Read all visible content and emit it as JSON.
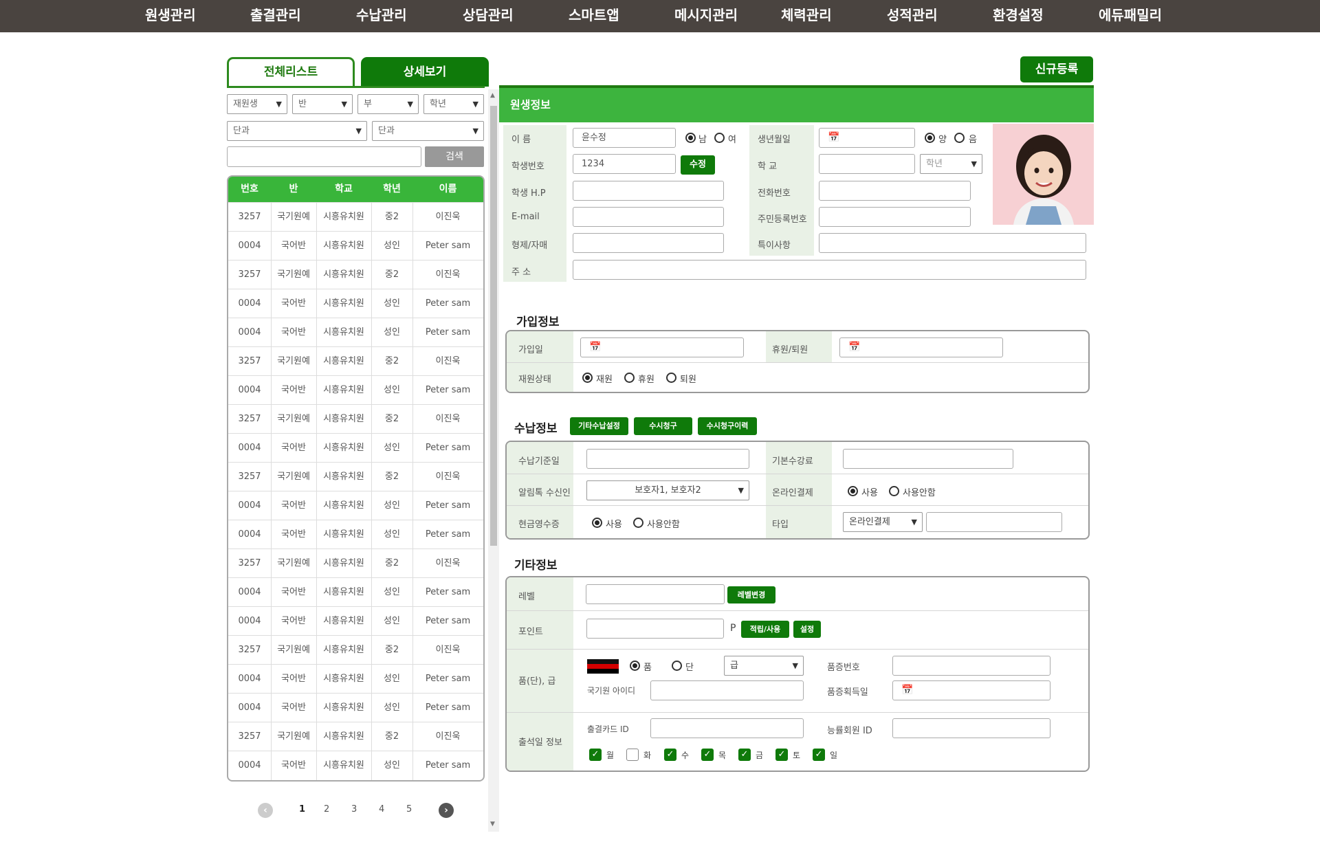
{
  "topnav": [
    "원생관리",
    "출결관리",
    "수납관리",
    "상담관리",
    "스마트앱",
    "메시지관리",
    "체력관리",
    "성적관리",
    "환경설정",
    "에듀패밀리"
  ],
  "tabs": {
    "list": "전체리스트",
    "detail": "상세보기"
  },
  "new_button": "신규등록",
  "filters": {
    "status": "재원생",
    "class": "반",
    "sub": "부",
    "grade": "학년",
    "course1": "단과",
    "course2": "단과",
    "search_button": "검색"
  },
  "student_table": {
    "headers": [
      "번호",
      "반",
      "학교",
      "학년",
      "이름"
    ],
    "rows": [
      [
        "3257",
        "국기원예",
        "시흥유치원",
        "중2",
        "이진욱"
      ],
      [
        "0004",
        "국어반",
        "시흥유치원",
        "성인",
        "Peter sam"
      ],
      [
        "3257",
        "국기원예",
        "시흥유치원",
        "중2",
        "이진욱"
      ],
      [
        "0004",
        "국어반",
        "시흥유치원",
        "성인",
        "Peter sam"
      ],
      [
        "0004",
        "국어반",
        "시흥유치원",
        "성인",
        "Peter sam"
      ],
      [
        "3257",
        "국기원예",
        "시흥유치원",
        "중2",
        "이진욱"
      ],
      [
        "0004",
        "국어반",
        "시흥유치원",
        "성인",
        "Peter sam"
      ],
      [
        "3257",
        "국기원예",
        "시흥유치원",
        "중2",
        "이진욱"
      ],
      [
        "0004",
        "국어반",
        "시흥유치원",
        "성인",
        "Peter sam"
      ],
      [
        "3257",
        "국기원예",
        "시흥유치원",
        "중2",
        "이진욱"
      ],
      [
        "0004",
        "국어반",
        "시흥유치원",
        "성인",
        "Peter sam"
      ],
      [
        "0004",
        "국어반",
        "시흥유치원",
        "성인",
        "Peter sam"
      ],
      [
        "3257",
        "국기원예",
        "시흥유치원",
        "중2",
        "이진욱"
      ],
      [
        "0004",
        "국어반",
        "시흥유치원",
        "성인",
        "Peter sam"
      ],
      [
        "0004",
        "국어반",
        "시흥유치원",
        "성인",
        "Peter sam"
      ],
      [
        "3257",
        "국기원예",
        "시흥유치원",
        "중2",
        "이진욱"
      ],
      [
        "0004",
        "국어반",
        "시흥유치원",
        "성인",
        "Peter sam"
      ],
      [
        "0004",
        "국어반",
        "시흥유치원",
        "성인",
        "Peter sam"
      ],
      [
        "3257",
        "국기원예",
        "시흥유치원",
        "중2",
        "이진욱"
      ],
      [
        "0004",
        "국어반",
        "시흥유치원",
        "성인",
        "Peter sam"
      ]
    ]
  },
  "pagination": {
    "pages": [
      "1",
      "2",
      "3",
      "4",
      "5"
    ],
    "current": "1"
  },
  "student_info": {
    "section_title": "원생정보",
    "name_label": "이 름",
    "name_value": "윤수정",
    "gender_male": "남",
    "gender_female": "여",
    "birth_label": "생년월일",
    "cal_solar": "양",
    "cal_lunar": "음",
    "id_label": "학생번호",
    "id_value": "1234",
    "edit_button": "수정",
    "school_label": "학 교",
    "grade_placeholder": "학년",
    "phone_label": "학생 H.P",
    "tel_label": "전화번호",
    "email_label": "E-mail",
    "rrn_label": "주민등록번호",
    "siblings_label": "형제/자매",
    "notes_label": "특이사항",
    "address_label": "주 소"
  },
  "join_info": {
    "title": "가입정보",
    "join_date_label": "가입일",
    "leave_label": "휴원/퇴원",
    "status_label": "재원상태",
    "status_options": [
      "재원",
      "휴원",
      "퇴원"
    ]
  },
  "payment_info": {
    "title": "수납정보",
    "buttons": [
      "기타수납설정",
      "수시청구",
      "수시청구이력"
    ],
    "base_date_label": "수납기준일",
    "base_fee_label": "기본수강료",
    "notify_label": "알림톡 수신인",
    "notify_value": "보호자1, 보호자2",
    "online_label": "온라인결제",
    "use": "사용",
    "not_use": "사용안함",
    "cash_label": "현금영수증",
    "type_label": "타입",
    "type_value": "온라인결제"
  },
  "etc_info": {
    "title": "기타정보",
    "level_label": "레벨",
    "level_button": "레벨변경",
    "point_label": "포인트",
    "point_unit": "P",
    "point_button": "적립/사용",
    "setting_button": "설정",
    "rank_label": "품(단), 급",
    "poom": "품",
    "dan": "단",
    "grade_select": "급",
    "cert_no_label": "품증번호",
    "kukkiwon_id_label": "국기원 아이디",
    "cert_date_label": "품증획득일",
    "attend_label": "출석일 정보",
    "card_id_label": "출결카드 ID",
    "member_id_label": "능률회원 ID",
    "days": [
      "월",
      "화",
      "수",
      "목",
      "금",
      "토",
      "일"
    ],
    "days_checked": [
      true,
      false,
      true,
      true,
      true,
      true,
      true
    ]
  },
  "colors": {
    "brand_green": "#0f7a0a",
    "header_green": "#3db43e",
    "nav_bg": "#4a4440"
  }
}
